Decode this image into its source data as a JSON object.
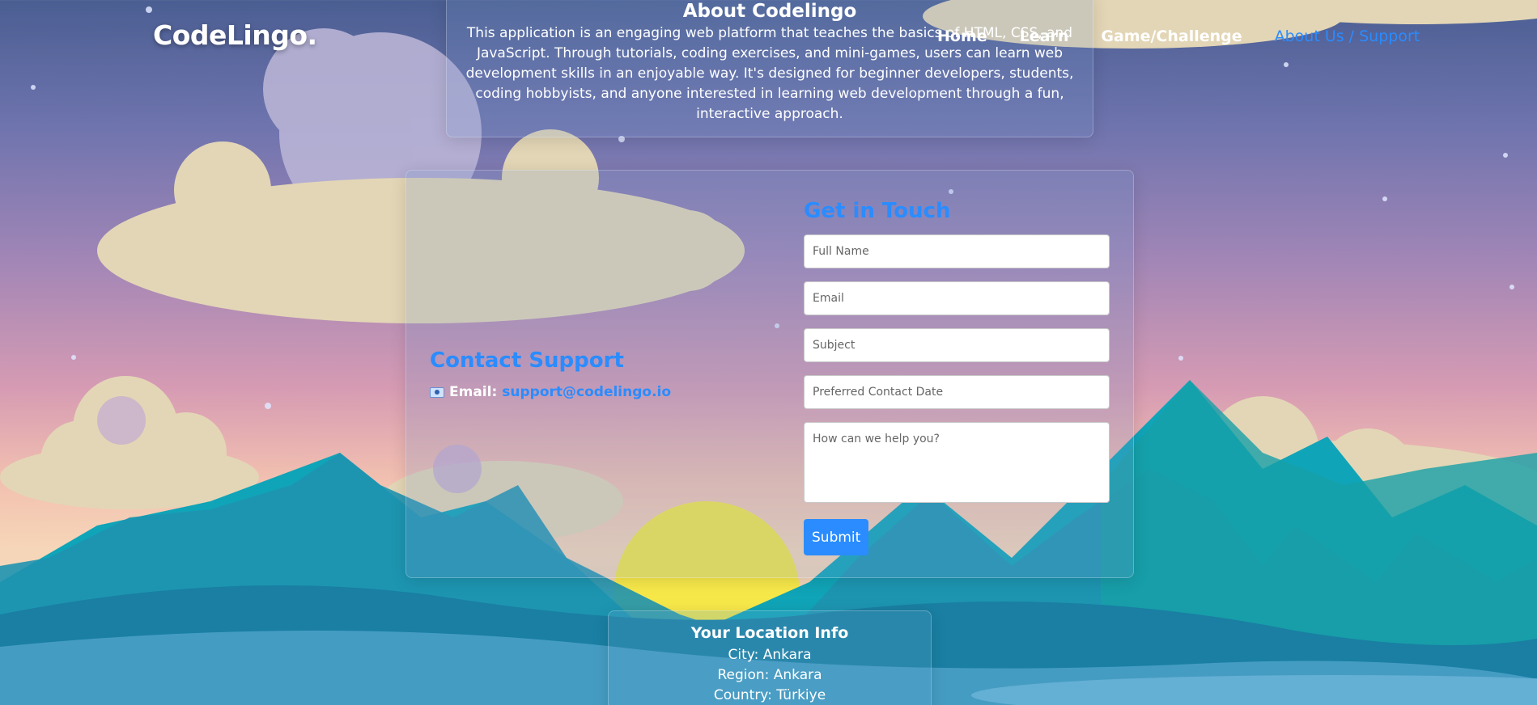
{
  "app": {
    "logo": "CodeLingo."
  },
  "nav": {
    "items": [
      {
        "label": "Home"
      },
      {
        "label": "Learn"
      },
      {
        "label": "Game/Challenge"
      },
      {
        "label": "About Us / Support",
        "active": true
      }
    ]
  },
  "about": {
    "title": "About Codelingo",
    "text": "This application is an engaging web platform that teaches the basics of HTML, CSS, and JavaScript. Through tutorials, coding exercises, and mini-games, users can learn web development skills in an enjoyable way. It's designed for beginner developers, students, coding hobbyists, and anyone interested in learning web development through a fun, interactive approach."
  },
  "contact_support": {
    "title": "Contact Support",
    "email_label": "Email:",
    "email": "support@codelingo.io",
    "icon": "envelope-icon"
  },
  "form": {
    "title": "Get in Touch",
    "full_name_placeholder": "Full Name",
    "email_placeholder": "Email",
    "subject_placeholder": "Subject",
    "date_placeholder": "Preferred Contact Date",
    "message_placeholder": "How can we help you?",
    "submit_label": "Submit"
  },
  "location": {
    "title": "Your Location Info",
    "city": "City: Ankara",
    "region": "Region: Ankara",
    "country": "Country: Türkiye"
  },
  "colors": {
    "accent": "#2a8cff",
    "mountain": "#1aa3b8",
    "sun": "#f7e84a"
  }
}
